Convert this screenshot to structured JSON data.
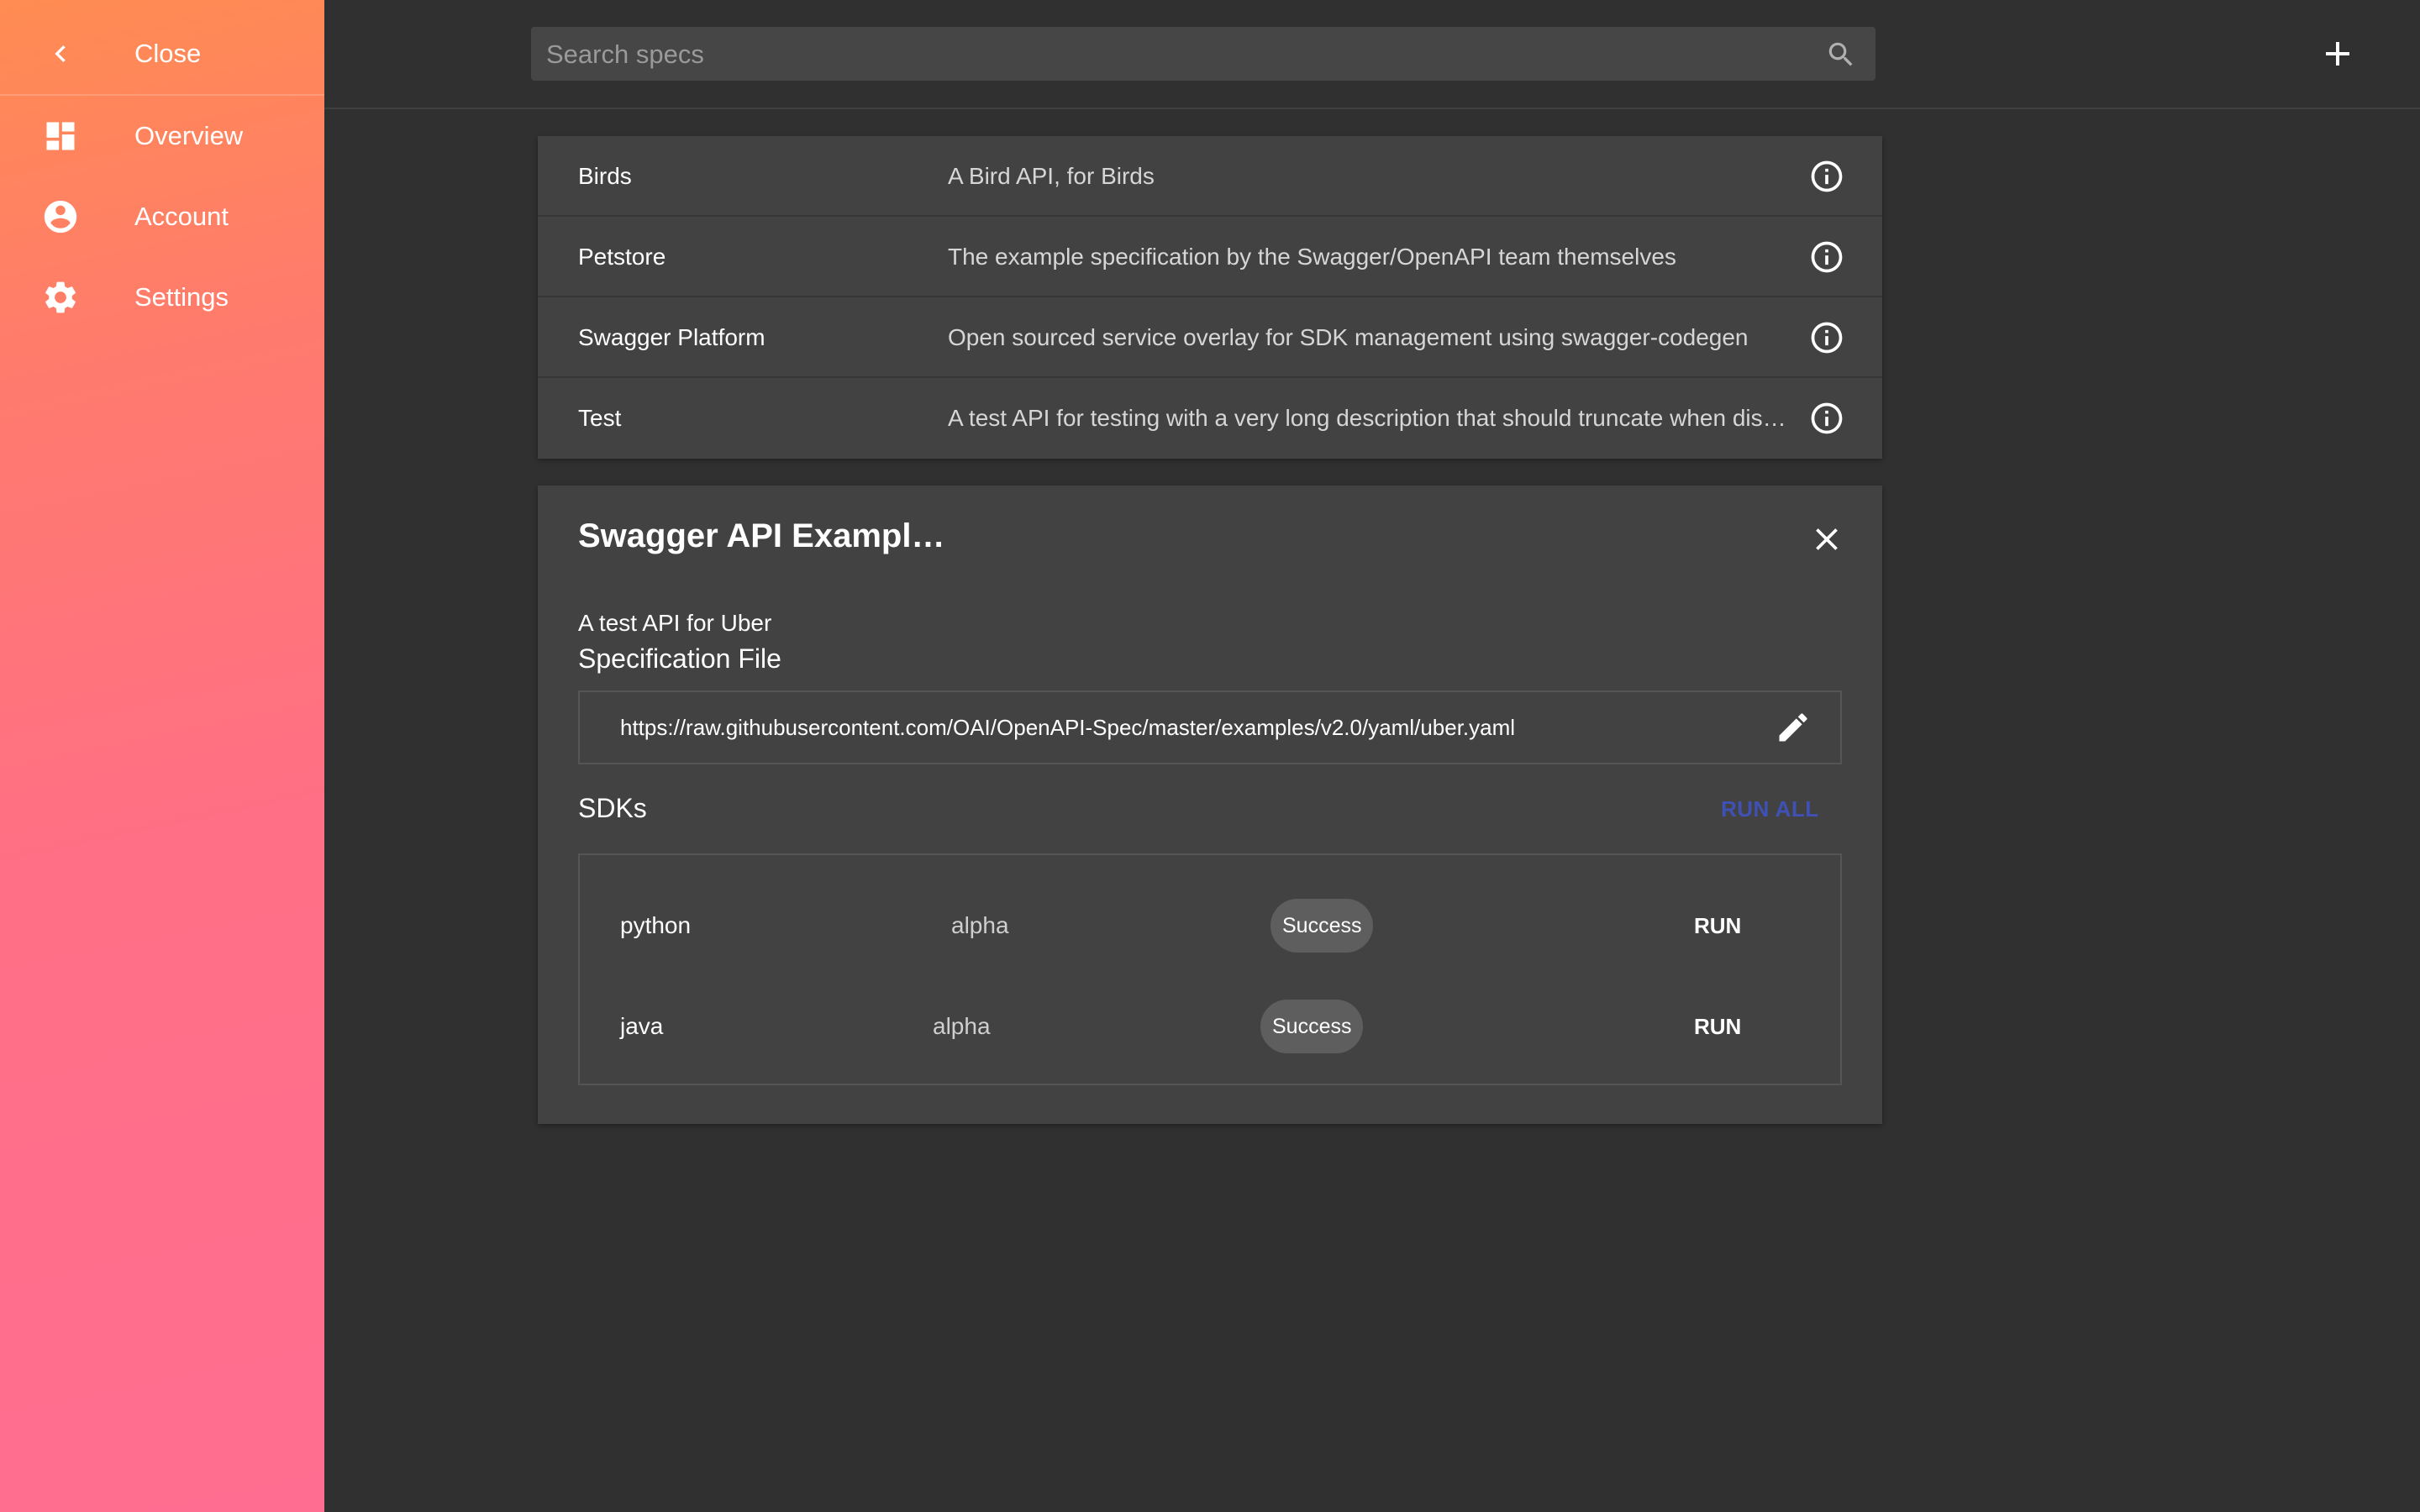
{
  "sidebar": {
    "close_label": "Close",
    "items": [
      {
        "label": "Overview",
        "icon": "dashboard-icon"
      },
      {
        "label": "Account",
        "icon": "account-circle-icon"
      },
      {
        "label": "Settings",
        "icon": "gear-icon"
      }
    ],
    "gradient_colors": [
      "#ff8c52",
      "#ff6e90"
    ]
  },
  "search": {
    "placeholder": "Search specs",
    "value": ""
  },
  "specs": [
    {
      "name": "Birds",
      "description": "A Bird API, for Birds"
    },
    {
      "name": "Petstore",
      "description": "The example specification by the Swagger/OpenAPI team themselves"
    },
    {
      "name": "Swagger Platform",
      "description": "Open sourced service overlay for SDK management using swagger-codegen"
    },
    {
      "name": "Test",
      "description": "A test API for testing with a very long description that should truncate when displayed"
    }
  ],
  "detail": {
    "title": "Swagger API Example Uber",
    "description": "A test API for Uber",
    "spec_file_heading": "Specification File",
    "spec_file_url": "https://raw.githubusercontent.com/OAI/OpenAPI-Spec/master/examples/v2.0/yaml/uber.yaml",
    "sdks_heading": "SDKs",
    "run_all_label": "RUN ALL",
    "sdks": [
      {
        "language": "python",
        "stage": "alpha",
        "status": "Success",
        "run_label": "RUN"
      },
      {
        "language": "java",
        "stage": "alpha",
        "status": "Success",
        "run_label": "RUN"
      }
    ]
  },
  "colors": {
    "background": "#303030",
    "card": "#424242",
    "accent": "#3f51b5",
    "chip": "#5e5e5e"
  }
}
